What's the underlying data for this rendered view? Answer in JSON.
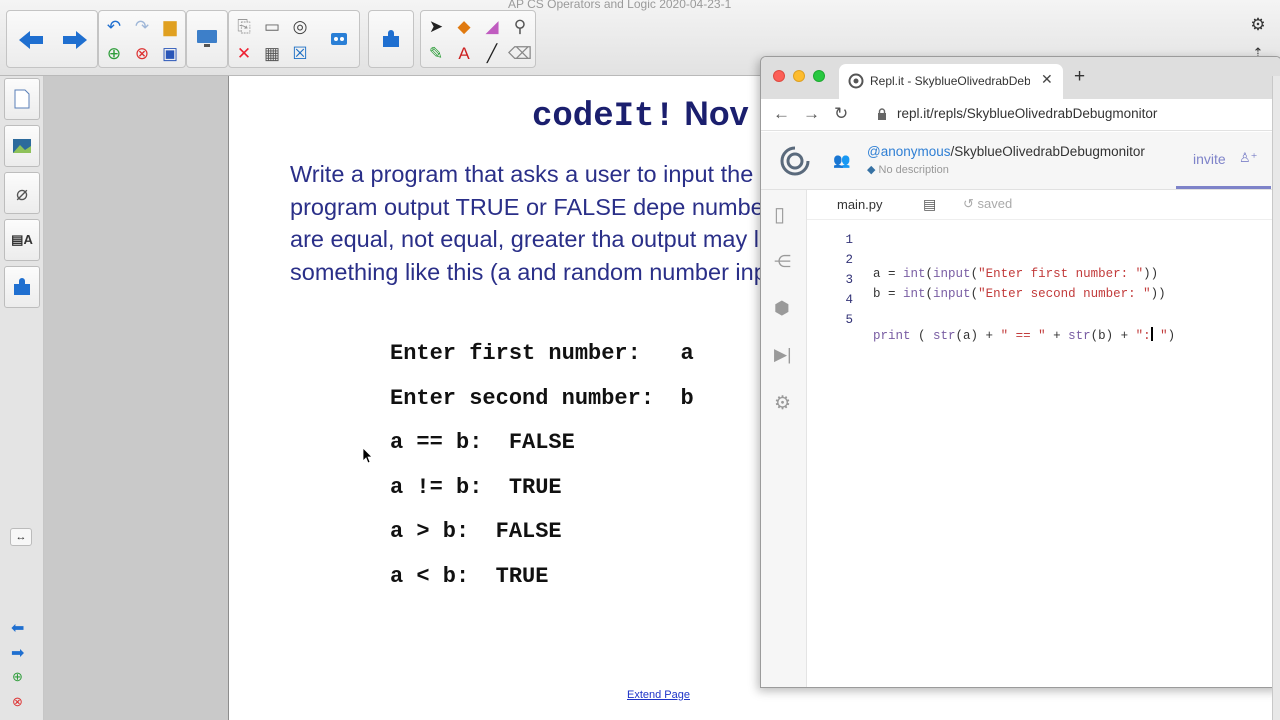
{
  "window": {
    "doc_title": "AP CS Operators and Logic 2020-04-23-1"
  },
  "toolbar": {
    "groups": [
      "navigation",
      "edit",
      "display",
      "addons",
      "tools"
    ]
  },
  "slide": {
    "title_code": "codeIt!",
    "title_rest": "Nov",
    "paragraph": "Write a program that asks a user to input the program output TRUE or FALSE depe numbers are equal, not equal, greater tha output may look something like this (a and random number input):",
    "lines": [
      "Enter first number:   a",
      "Enter second number:  b",
      "a == b:  FALSE",
      "a != b:  TRUE",
      "a > b:  FALSE",
      "a < b:  TRUE"
    ],
    "extend_link": "Extend Page"
  },
  "browser": {
    "tab_title": "Repl.it - SkyblueOlivedrabDebi",
    "new_tab": "+",
    "url": "repl.it/repls/SkyblueOlivedrabDebugmonitor",
    "repl": {
      "owner": "@anonymous",
      "name": "/SkyblueOlivedrabDebugmonitor",
      "description": "No description",
      "invite_label": "invite"
    },
    "file_tab": "main.py",
    "save_status": "saved",
    "code": [
      {
        "n": "1",
        "text": ""
      },
      {
        "n": "2",
        "text": "a = int(input(\"Enter first number: \"))"
      },
      {
        "n": "3",
        "text": "b = int(input(\"Enter second number: \"))"
      },
      {
        "n": "4",
        "text": ""
      },
      {
        "n": "5",
        "text": "print ( str(a) + \" == \" + str(b) + \":\")"
      }
    ]
  },
  "colors": {
    "slide_text": "#2a2f88",
    "title": "#1b1f6e",
    "accent": "#2f7fd4",
    "invite": "#7e83c9"
  }
}
